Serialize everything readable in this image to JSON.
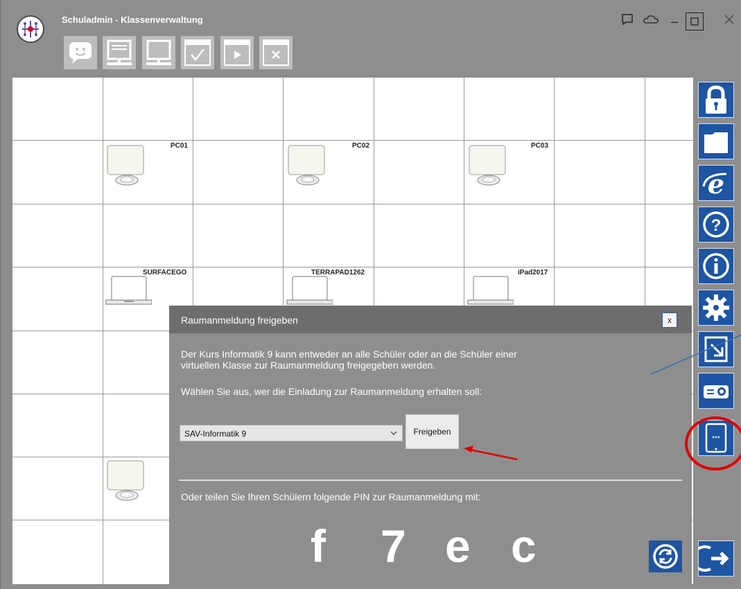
{
  "window": {
    "title": "Schuladmin - Klassenverwaltung",
    "controls": [
      "minimize",
      "maximize",
      "close"
    ]
  },
  "toolbar": {
    "buttons": [
      {
        "name": "message-icon"
      },
      {
        "name": "monitor-lock-icon"
      },
      {
        "name": "monitor-icon"
      },
      {
        "name": "window-check-icon"
      },
      {
        "name": "window-play-icon"
      },
      {
        "name": "window-close-icon"
      }
    ]
  },
  "grid": {
    "devices": [
      {
        "label": "PC01",
        "type": "pc"
      },
      {
        "label": "PC02",
        "type": "pc"
      },
      {
        "label": "PC03",
        "type": "pc"
      },
      {
        "label": "SURFACEGO",
        "type": "laptop"
      },
      {
        "label": "TERRAPAD1262",
        "type": "laptop"
      },
      {
        "label": "iPad2017",
        "type": "laptop"
      },
      {
        "label": "",
        "type": "pc"
      }
    ]
  },
  "sidebar": {
    "buttons": [
      "lock-icon",
      "folder-icon",
      "internet-explorer-icon",
      "help-icon",
      "info-icon",
      "settings-gear-icon",
      "export-icon",
      "projector-icon",
      "tablet-pin-icon",
      "exit-icon"
    ]
  },
  "dialog": {
    "title": "Raumanmeldung freigeben",
    "close_label": "x",
    "intro_line1": "Der Kurs Informatik 9 kann entweder an alle Schüler oder an die Schüler einer",
    "intro_line2": "virtuellen Klasse zur Raumanmeldung freigegeben werden.",
    "choose_text": "Wählen Sie aus, wer die Einladung zur Raumanmeldung erhalten soll:",
    "select_value": "SAV-Informatik 9",
    "share_button": "Freigeben",
    "pin_text": "Oder teilen Sie Ihren Schülern folgende PIN zur Raumanmeldung mit:",
    "pin": [
      "f",
      "7",
      "e",
      "c"
    ]
  },
  "colors": {
    "accent": "#1e55a3",
    "dialog_bg": "#8e8e8e",
    "annotation": "#e00000"
  }
}
